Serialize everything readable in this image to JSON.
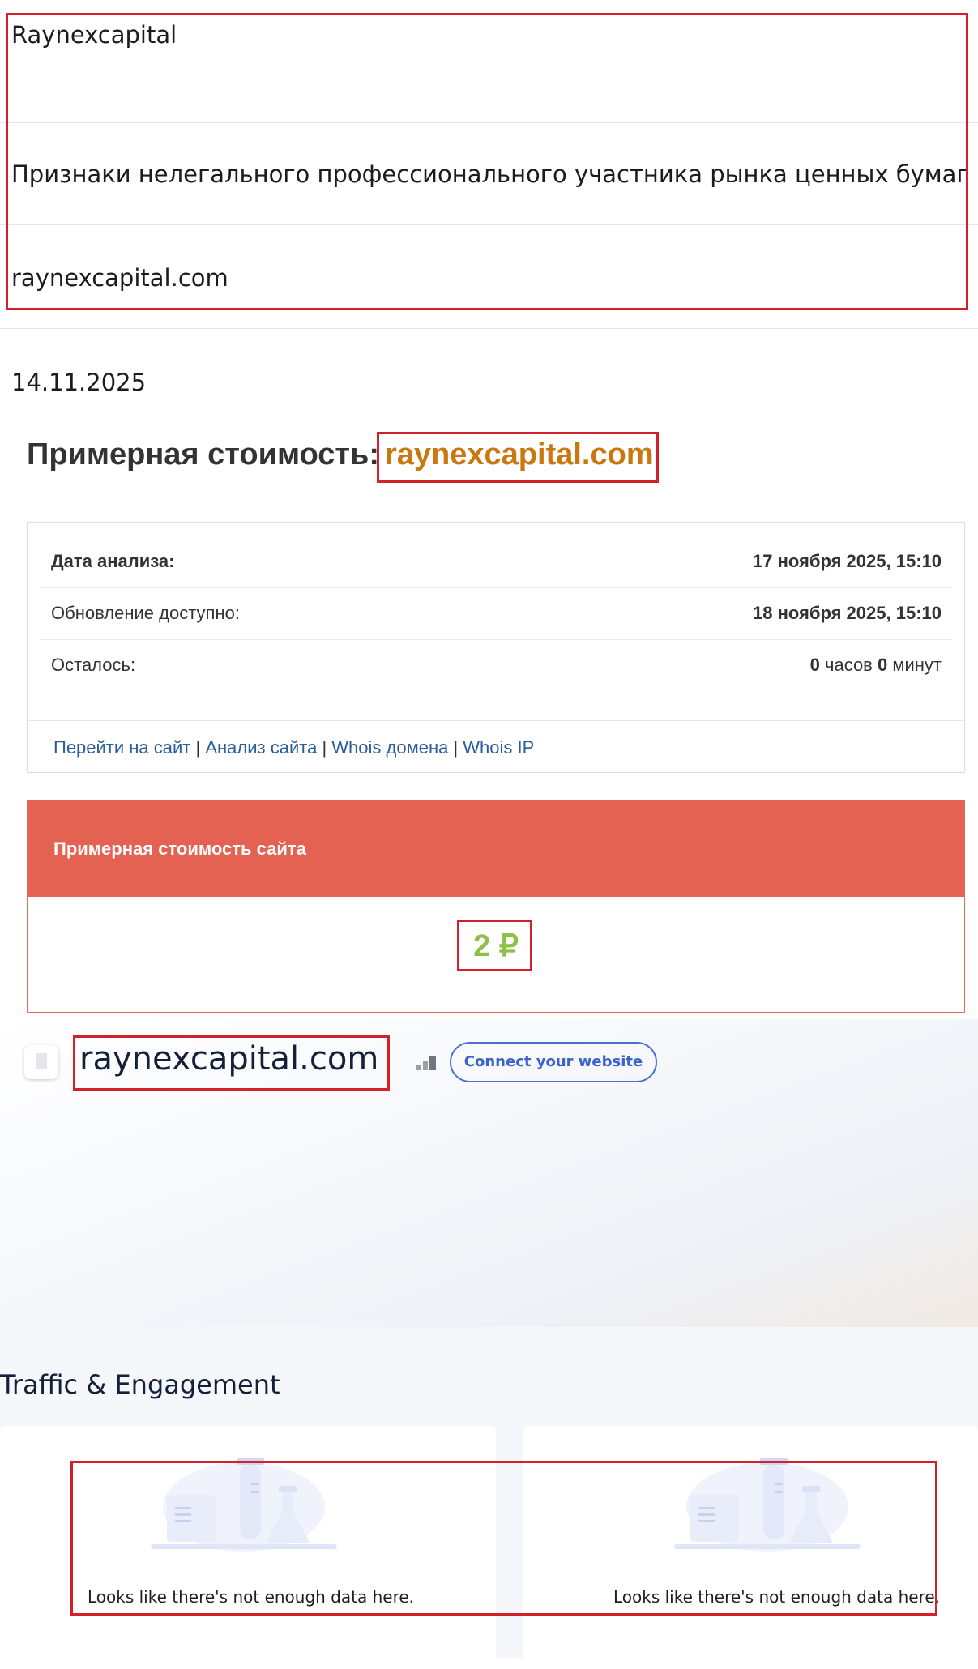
{
  "header": {
    "company": "Raynexcapital",
    "warning": "Признаки нелегального профессионального участника рынка ценных бумаг",
    "domain": "raynexcapital.com"
  },
  "date": "14.11.2025",
  "price_title": {
    "label": "Примерная стоимость:",
    "domain": "raynexcapital.com"
  },
  "analysis_panel": {
    "analysis_date_label": "Дата анализа:",
    "analysis_date_value": "17 ноября 2025, 15:10",
    "update_label": "Обновление доступно:",
    "update_value": "18 ноября 2025, 15:10",
    "remaining_label": "Осталось:",
    "remaining_hours": "0",
    "remaining_hours_unit": " часов ",
    "remaining_minutes": "0",
    "remaining_minutes_unit": " минут",
    "links": [
      "Перейти на сайт",
      "Анализ сайта",
      "Whois домена",
      "Whois IP"
    ],
    "separator": " | "
  },
  "cost_box": {
    "header": "Примерная стоимость сайта",
    "value": "2 ₽"
  },
  "similarweb": {
    "domain": "raynexcapital.com",
    "connect_button": "Connect your website"
  },
  "traffic": {
    "title": "Traffic & Engagement",
    "no_data_1": "Looks like there's not enough data here.",
    "no_data_2": "Looks like there's not enough data here."
  },
  "colors": {
    "highlight_border": "#d4202a",
    "domain_orange": "#c9770e",
    "cost_header": "#e46251",
    "cost_value": "#8fc046",
    "link_blue": "#2a5e9a",
    "connect_blue": "#3b62cf"
  },
  "icons": [
    "file-icon",
    "rank-bars-icon",
    "empty-lab-illustration"
  ]
}
